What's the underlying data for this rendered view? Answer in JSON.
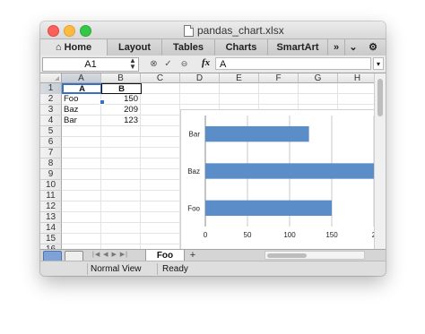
{
  "window": {
    "title": "pandas_chart.xlsx"
  },
  "ribbon": {
    "tabs": [
      "Home",
      "Layout",
      "Tables",
      "Charts",
      "SmartArt"
    ],
    "more": "»",
    "collapse": "⌄",
    "settings": "⚙"
  },
  "formula_bar": {
    "name_box": "A1",
    "fx": "fx",
    "value": "A"
  },
  "sheet": {
    "columns": [
      "A",
      "B",
      "C",
      "D",
      "E",
      "F",
      "G",
      "H"
    ],
    "rows": [
      "1",
      "2",
      "3",
      "4",
      "5",
      "6",
      "7",
      "8",
      "9",
      "10",
      "11",
      "12",
      "13",
      "14",
      "15",
      "16"
    ],
    "cells": {
      "A1": "A",
      "B1": "B",
      "A2": "Foo",
      "B2": "150",
      "A3": "Baz",
      "B3": "209",
      "A4": "Bar",
      "B4": "123"
    }
  },
  "chart_data": {
    "type": "bar",
    "orientation": "horizontal",
    "categories": [
      "Foo",
      "Baz",
      "Bar"
    ],
    "values": [
      150,
      209,
      123
    ],
    "xlim": [
      0,
      200
    ],
    "xticks": [
      "0",
      "50",
      "100",
      "150",
      "2"
    ],
    "grid": true,
    "bar_color": "#5b8ec9"
  },
  "tabs": {
    "nav": "|◀ ◀ ▶ ▶|",
    "sheet_name": "Foo",
    "add": "+"
  },
  "status": {
    "view": "Normal View",
    "state": "Ready"
  },
  "colors": {
    "accent": "#3b6fc4",
    "bar": "#5b8ec9"
  }
}
